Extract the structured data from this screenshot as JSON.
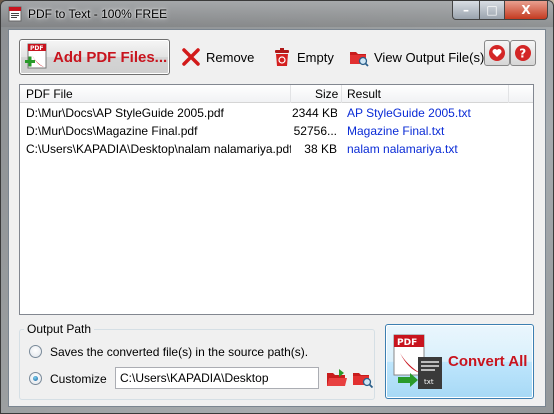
{
  "window": {
    "title": "PDF to Text - 100% FREE",
    "min_glyph": "–",
    "max_glyph": "□",
    "close_glyph": "X"
  },
  "toolbar": {
    "add_label": "Add PDF Files...",
    "remove_label": "Remove",
    "empty_label": "Empty",
    "view_label": "View Output File(s)"
  },
  "list": {
    "columns": [
      "PDF File",
      "Size",
      "Result"
    ],
    "rows": [
      {
        "file": "D:\\Mur\\Docs\\AP StyleGuide 2005.pdf",
        "size": "2344 KB",
        "result": "AP StyleGuide 2005.txt"
      },
      {
        "file": "D:\\Mur\\Docs\\Magazine Final.pdf",
        "size": "52756...",
        "result": "Magazine Final.txt"
      },
      {
        "file": "C:\\Users\\KAPADIA\\Desktop\\nalam nalamariya.pdf",
        "size": "38 KB",
        "result": "nalam nalamariya.txt"
      }
    ]
  },
  "output": {
    "group_label": "Output Path",
    "option_source": "Saves the converted file(s) in the source path(s).",
    "option_custom": "Customize",
    "selected": "custom",
    "path_value": "C:\\Users\\KAPADIA\\Desktop"
  },
  "convert": {
    "label": "Convert All"
  },
  "colors": {
    "accent_red": "#c8141e",
    "result_blue": "#0a2bd6",
    "convert_border": "#3c7fb1"
  },
  "icons": {
    "add": "pdf-add-icon",
    "remove": "red-x-icon",
    "empty": "trash-icon",
    "view": "folder-search-icon",
    "heart": "heart-icon",
    "help": "help-icon",
    "browse": "folder-open-icon",
    "open_output": "folder-search-icon",
    "convert": "pdf-to-txt-icon"
  }
}
